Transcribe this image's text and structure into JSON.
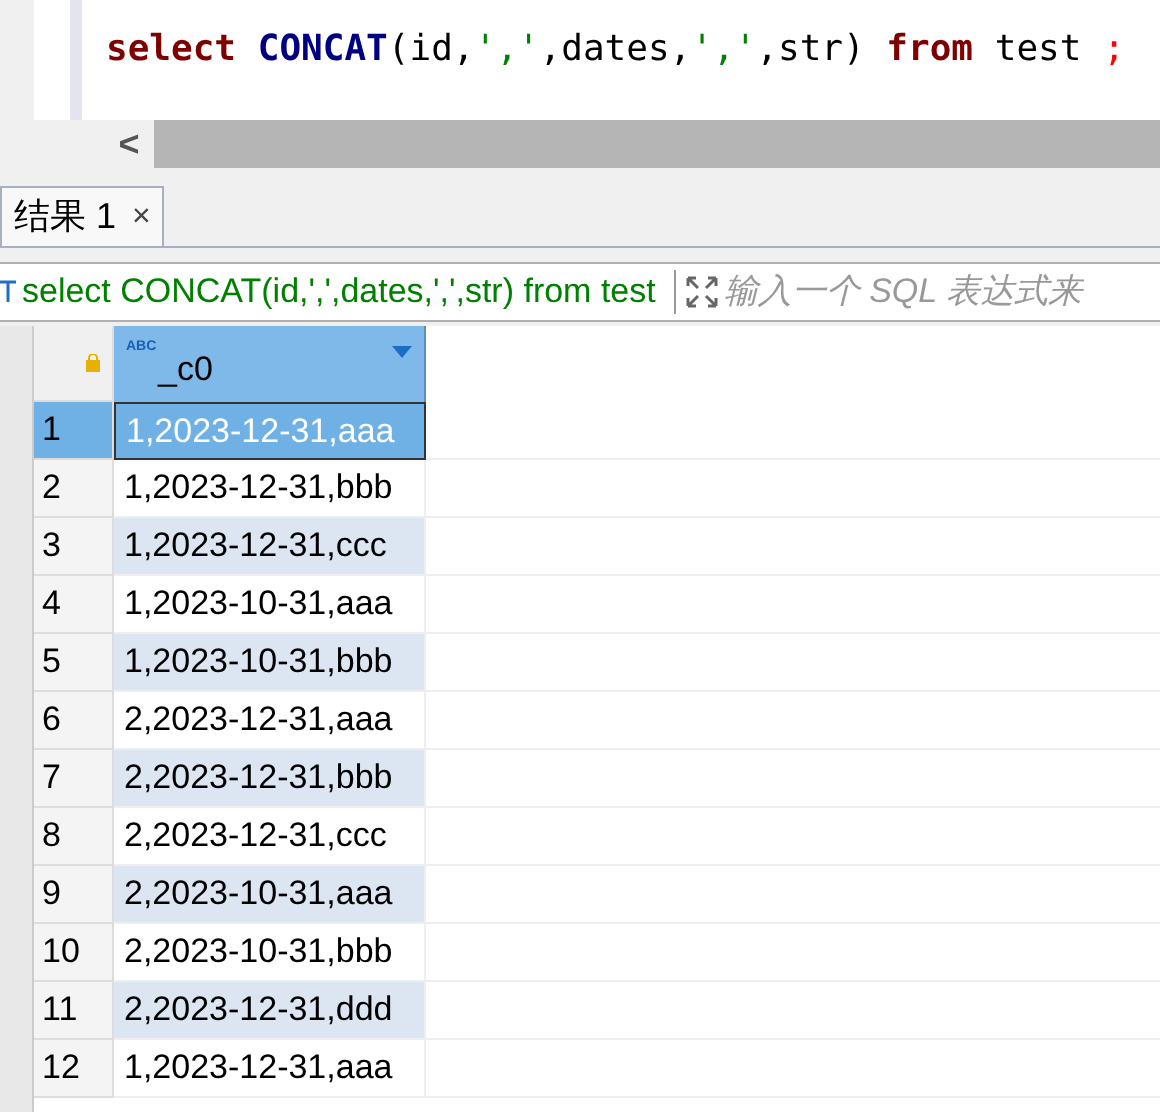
{
  "editor": {
    "tokens": [
      {
        "kind": "keyword",
        "text": "select "
      },
      {
        "kind": "function",
        "text": "CONCAT"
      },
      {
        "kind": "plain",
        "text": "(id,"
      },
      {
        "kind": "string",
        "text": "','"
      },
      {
        "kind": "plain",
        "text": ",dates,"
      },
      {
        "kind": "string",
        "text": "','"
      },
      {
        "kind": "plain",
        "text": ",str) "
      },
      {
        "kind": "keyword",
        "text": "from"
      },
      {
        "kind": "plain",
        "text": " test "
      },
      {
        "kind": "delimiter",
        "text": ";"
      }
    ]
  },
  "scrollbar": {
    "left_button": "<"
  },
  "tabs": [
    {
      "label": "结果 1",
      "selected": true,
      "close": "×"
    }
  ],
  "filter": {
    "query": "select CONCAT(id,',',dates,',',str) from test",
    "placeholder": "输入一个 SQL 表达式来"
  },
  "table": {
    "columns": [
      {
        "label": "_c0",
        "type_badge": "ABC"
      }
    ],
    "rows": [
      {
        "num": "1",
        "value": "1,2023-12-31,aaa",
        "selected": true
      },
      {
        "num": "2",
        "value": "1,2023-12-31,bbb",
        "selected": false
      },
      {
        "num": "3",
        "value": "1,2023-12-31,ccc",
        "selected": false
      },
      {
        "num": "4",
        "value": "1,2023-10-31,aaa",
        "selected": false
      },
      {
        "num": "5",
        "value": "1,2023-10-31,bbb",
        "selected": false
      },
      {
        "num": "6",
        "value": "2,2023-12-31,aaa",
        "selected": false
      },
      {
        "num": "7",
        "value": "2,2023-12-31,bbb",
        "selected": false
      },
      {
        "num": "8",
        "value": "2,2023-12-31,ccc",
        "selected": false
      },
      {
        "num": "9",
        "value": "2,2023-10-31,aaa",
        "selected": false
      },
      {
        "num": "10",
        "value": "2,2023-10-31,bbb",
        "selected": false
      },
      {
        "num": "11",
        "value": "2,2023-12-31,ddd",
        "selected": false
      },
      {
        "num": "12",
        "value": "1,2023-12-31,aaa",
        "selected": false
      }
    ]
  }
}
